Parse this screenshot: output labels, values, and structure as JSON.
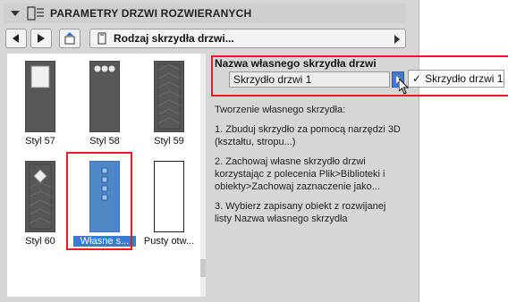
{
  "header": {
    "title": "PARAMETRY DRZWI ROZWIERANYCH"
  },
  "toolbar": {
    "dropdown_label": "Rodzaj skrzydła drzwi..."
  },
  "gallery": {
    "items": [
      {
        "label": "Styl 57"
      },
      {
        "label": "Styl 58"
      },
      {
        "label": "Styl 59"
      },
      {
        "label": "Styl 60"
      },
      {
        "label": "Własne s..."
      },
      {
        "label": "Pusty otw..."
      }
    ]
  },
  "custom_leaf": {
    "section_title": "Nazwa własnego skrzydła drzwi",
    "name_value": "Skrzydło drzwi 1",
    "popup_option": "Skrzydło drzwi 1"
  },
  "instructions": {
    "intro": "Tworzenie własnego skrzydła:",
    "step1": "1. Zbuduj skrzydło za pomocą narzędzi 3D (kształtu, stropu...)",
    "step2": "2. Zachowaj własne skrzydło drzwi korzystając z polecenia Plik>Biblioteki i obiekty>Zachowaj zaznaczenie jako...",
    "step3": "3. Wybierz zapisany obiekt z rozwijanej listy Nazwa własnego skrzydła"
  },
  "colors": {
    "accent": "#3a7bd5",
    "highlight": "#e02020"
  }
}
